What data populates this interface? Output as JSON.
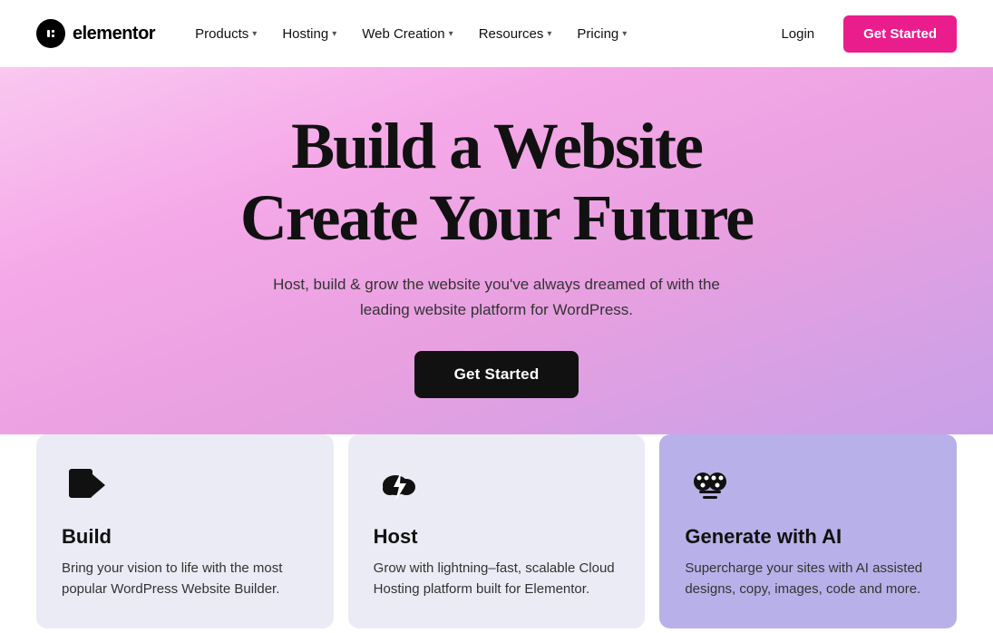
{
  "nav": {
    "logo_text": "elementor",
    "logo_icon": "e",
    "items": [
      {
        "label": "Products",
        "has_dropdown": true
      },
      {
        "label": "Hosting",
        "has_dropdown": true
      },
      {
        "label": "Web Creation",
        "has_dropdown": true
      },
      {
        "label": "Resources",
        "has_dropdown": true
      },
      {
        "label": "Pricing",
        "has_dropdown": true
      }
    ],
    "login_label": "Login",
    "cta_label": "Get Started"
  },
  "hero": {
    "title_line1": "Build a Website",
    "title_line2": "Create Your Future",
    "subtitle": "Host, build & grow the website you've always dreamed of with the leading website platform for WordPress.",
    "cta_label": "Get Started"
  },
  "cards": [
    {
      "id": "build",
      "title": "Build",
      "description": "Bring your vision to life with the most popular WordPress Website Builder.",
      "icon": "build-icon"
    },
    {
      "id": "host",
      "title": "Host",
      "description": "Grow with lightning–fast, scalable Cloud Hosting platform built for Elementor.",
      "icon": "host-icon"
    },
    {
      "id": "ai",
      "title": "Generate with AI",
      "description": "Supercharge your sites with AI assisted designs, copy, images, code and more.",
      "icon": "ai-icon"
    }
  ]
}
